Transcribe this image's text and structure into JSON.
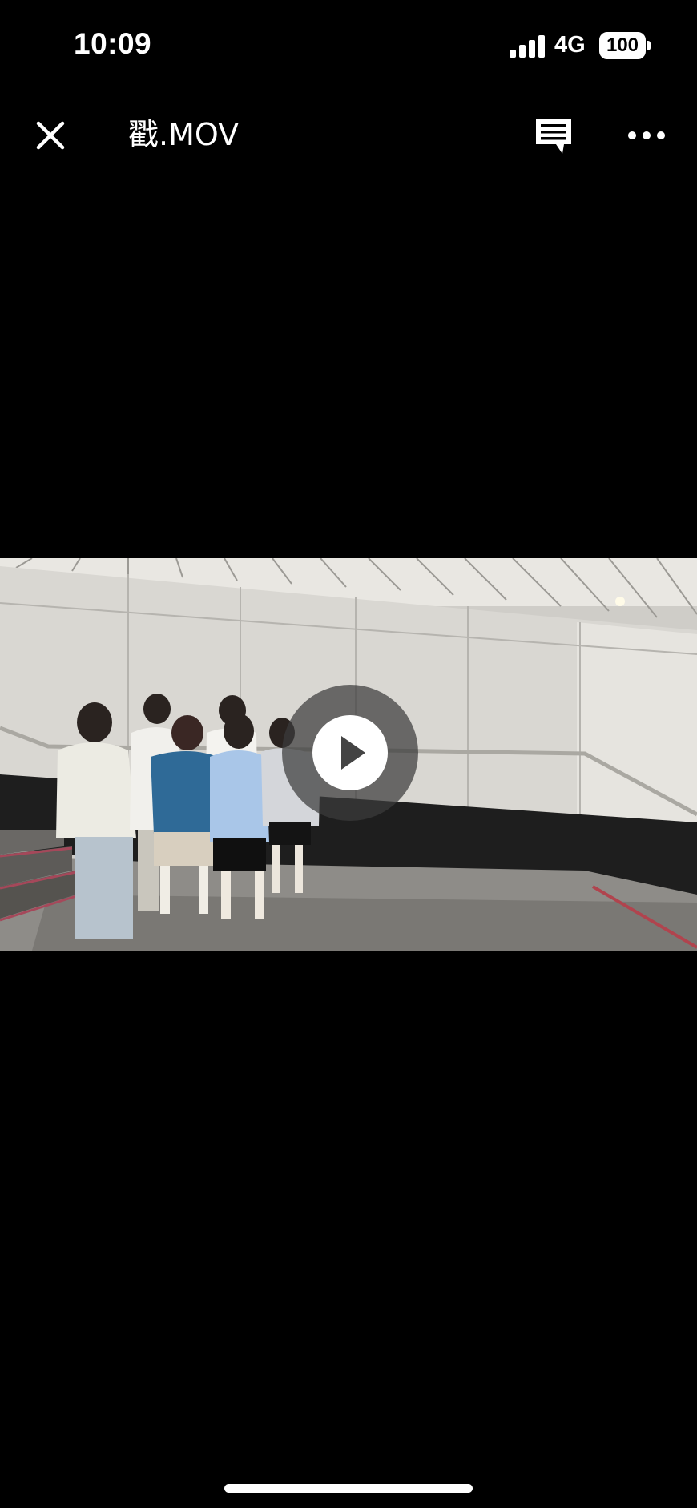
{
  "status_bar": {
    "time": "10:09",
    "network": "4G",
    "battery": "100"
  },
  "header": {
    "title": "戳.MOV"
  },
  "icons": {
    "close": "close-icon",
    "comment": "comment-icon",
    "more": "more-icon",
    "play": "play-icon"
  },
  "colors": {
    "background": "#000000",
    "overlay": "#3c3c3c",
    "foreground": "#ffffff"
  }
}
